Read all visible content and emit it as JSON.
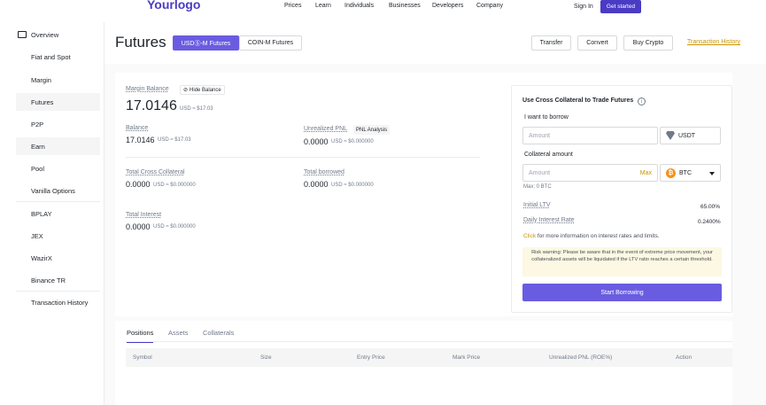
{
  "nav": {
    "logo": "Yourlogo",
    "links": [
      "Prices",
      "Learn",
      "Individuals",
      "Businesses",
      "Developers",
      "Company"
    ],
    "signin": "Sign In",
    "get_started": "Get started"
  },
  "sidebar": {
    "items": [
      {
        "label": "Overview"
      },
      {
        "label": "Fiat and Spot"
      },
      {
        "label": "Margin"
      },
      {
        "label": "Futures"
      },
      {
        "label": "P2P"
      },
      {
        "label": "Earn"
      },
      {
        "label": "Pool"
      },
      {
        "label": "Vanilla Options"
      },
      {
        "label": "BPLAY"
      },
      {
        "label": "JEX"
      },
      {
        "label": "WazirX"
      },
      {
        "label": "Binance TR"
      },
      {
        "label": "Transaction History"
      }
    ]
  },
  "header": {
    "title": "Futures",
    "tab_usd": "USDⓈ-M Futures",
    "tab_coin": "COIN-M Futures",
    "transfer": "Transfer",
    "convert": "Convert",
    "buy_crypto": "Buy Crypto",
    "transaction_history": "Transaction History"
  },
  "balance": {
    "margin_balance_label": "Margin Balance",
    "hide_balance": "Hide Balance",
    "margin_balance_value": "17.0146",
    "margin_balance_usd": "USD ≈ $17.03",
    "balance_label": "Balance",
    "balance_value": "17.0146",
    "balance_usd": "USD ≈ $17.03",
    "unrealized_label": "Unrealized PNL",
    "pnl_analysis": "PNL Analysis",
    "unrealized_value": "0.0000",
    "unrealized_usd": "USD ≈ $0.000000",
    "cross_collateral_label": "Total Cross Collateral",
    "cross_collateral_value": "0.0000",
    "cross_collateral_usd": "USD ≈ $0.000000",
    "total_borrowed_label": "Total borrowed",
    "total_borrowed_value": "0.0000",
    "total_borrowed_usd": "USD ≈ $0.000000",
    "total_interest_label": "Total Interest",
    "total_interest_value": "0.0000",
    "total_interest_usd": "USD ≈ $0.000000"
  },
  "panel": {
    "title": "Use Cross Collateral to Trade Futures",
    "want_borrow": "I want to borrow",
    "amount_placeholder": "Amount",
    "borrow_coin": "USDT",
    "collateral_label": "Collateral amount",
    "collateral_placeholder": "Amount",
    "max": "Max",
    "collateral_coin": "BTC",
    "max_btc": "Max: 0 BTC",
    "initial_ltv_label": "Initial LTV",
    "initial_ltv_value": "65.00%",
    "daily_rate_label": "Daily Interest Rate",
    "daily_rate_value": "0.2400%",
    "click": "Click",
    "click_rest": " for more information on interest rates and limits.",
    "warning": "Risk warning: Please be aware that in the event of extreme price movement, your collateralized assets will be liquidated if the LTV ratio reaches a certain threshold.",
    "start_borrowing": "Start Borrowing"
  },
  "bottom": {
    "tabs": [
      "Positions",
      "Assets",
      "Collaterals"
    ],
    "columns": [
      "Symbol",
      "Size",
      "Entry Price",
      "Mark Price",
      "Unrealized PNL (ROE%)",
      "Action"
    ]
  },
  "colors": {
    "accent": "#4a3bc4",
    "tab_active": "#6a5ce0",
    "link": "#c99400"
  }
}
